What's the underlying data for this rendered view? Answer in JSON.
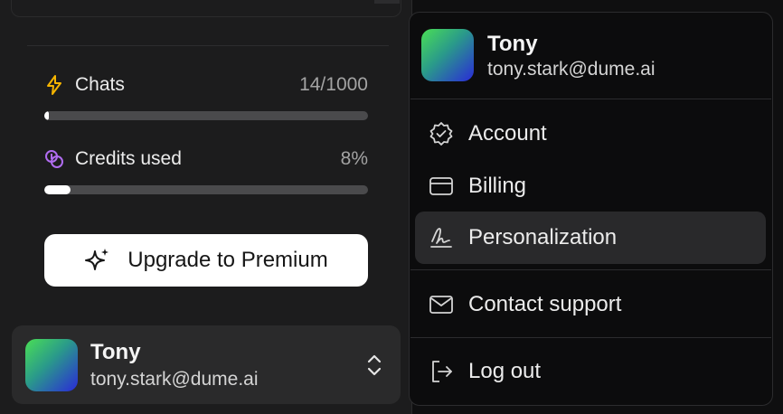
{
  "usage": {
    "chats": {
      "label": "Chats",
      "value": "14/1000",
      "fraction": 0.014,
      "icon": "lightning-icon",
      "color": "#f5b400"
    },
    "credits": {
      "label": "Credits used",
      "value": "8%",
      "fraction": 0.08,
      "icon": "coins-icon",
      "color": "#b06cf0"
    }
  },
  "upgrade": {
    "label": "Upgrade to Premium",
    "icon": "sparkle-icon"
  },
  "user": {
    "name": "Tony",
    "email": "tony.stark@dume.ai"
  },
  "menu": {
    "header": {
      "name": "Tony",
      "email": "tony.stark@dume.ai"
    },
    "items": [
      {
        "label": "Account",
        "icon": "badge-check-icon"
      },
      {
        "label": "Billing",
        "icon": "credit-card-icon"
      },
      {
        "label": "Personalization",
        "icon": "signature-icon",
        "active": true
      },
      {
        "label": "Contact support",
        "icon": "mail-icon"
      },
      {
        "label": "Log out",
        "icon": "log-out-icon"
      }
    ]
  }
}
